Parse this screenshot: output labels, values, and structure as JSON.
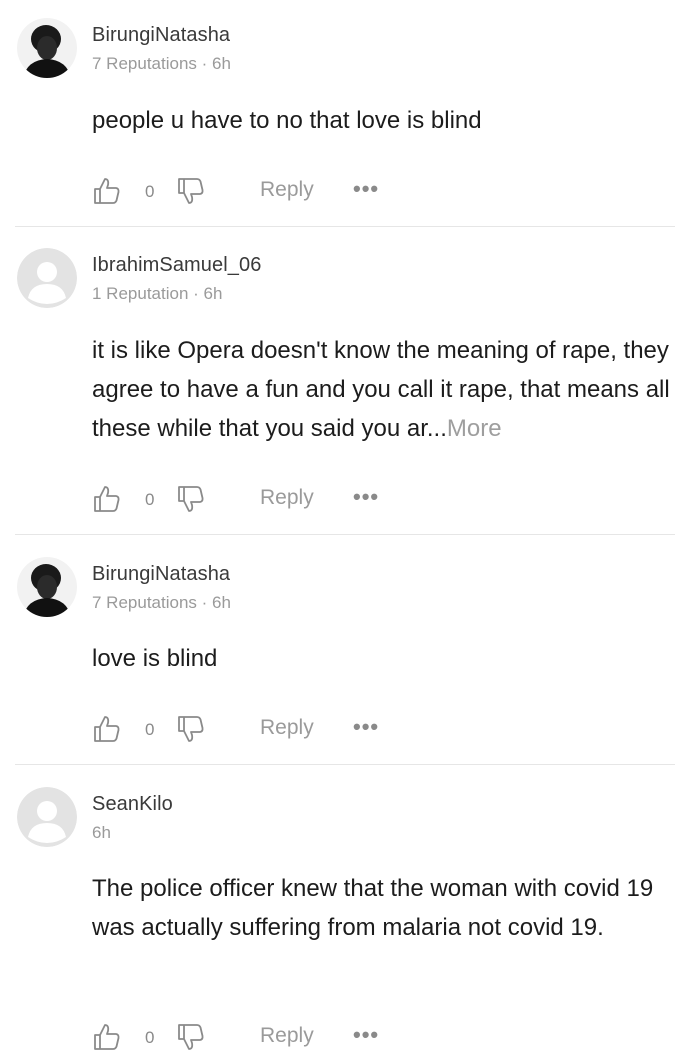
{
  "comments": [
    {
      "username": "BirungiNatasha",
      "meta": "7 Reputations · 6h",
      "body": "people u have to no that love is blind",
      "more": "",
      "likes": "0",
      "reply": "Reply",
      "avatar": "photo"
    },
    {
      "username": "IbrahimSamuel_06",
      "meta": "1 Reputation · 6h",
      "body": "it is like Opera doesn't know the meaning of rape, they agree to have a fun and you call it rape, that means all these while that you said you ar...",
      "more": "More",
      "likes": "0",
      "reply": "Reply",
      "avatar": "default"
    },
    {
      "username": "BirungiNatasha",
      "meta": "7 Reputations · 6h",
      "body": "love is blind",
      "more": "",
      "likes": "0",
      "reply": "Reply",
      "avatar": "photo"
    },
    {
      "username": "SeanKilo",
      "meta": "6h",
      "body": "The police officer knew that the woman with covid 19  was actually suffering from malaria not covid 19.",
      "more": "",
      "likes": "0",
      "reply": "Reply",
      "avatar": "default"
    }
  ],
  "icons": {
    "like": "thumbs-up-outline-icon",
    "dislike": "thumbs-down-outline-icon",
    "more": "ellipsis-icon"
  },
  "colors": {
    "text": "#1c1c1c",
    "muted": "#9a9a9a",
    "divider": "#e6e6e6",
    "default_avatar": "#e3e3e3"
  }
}
